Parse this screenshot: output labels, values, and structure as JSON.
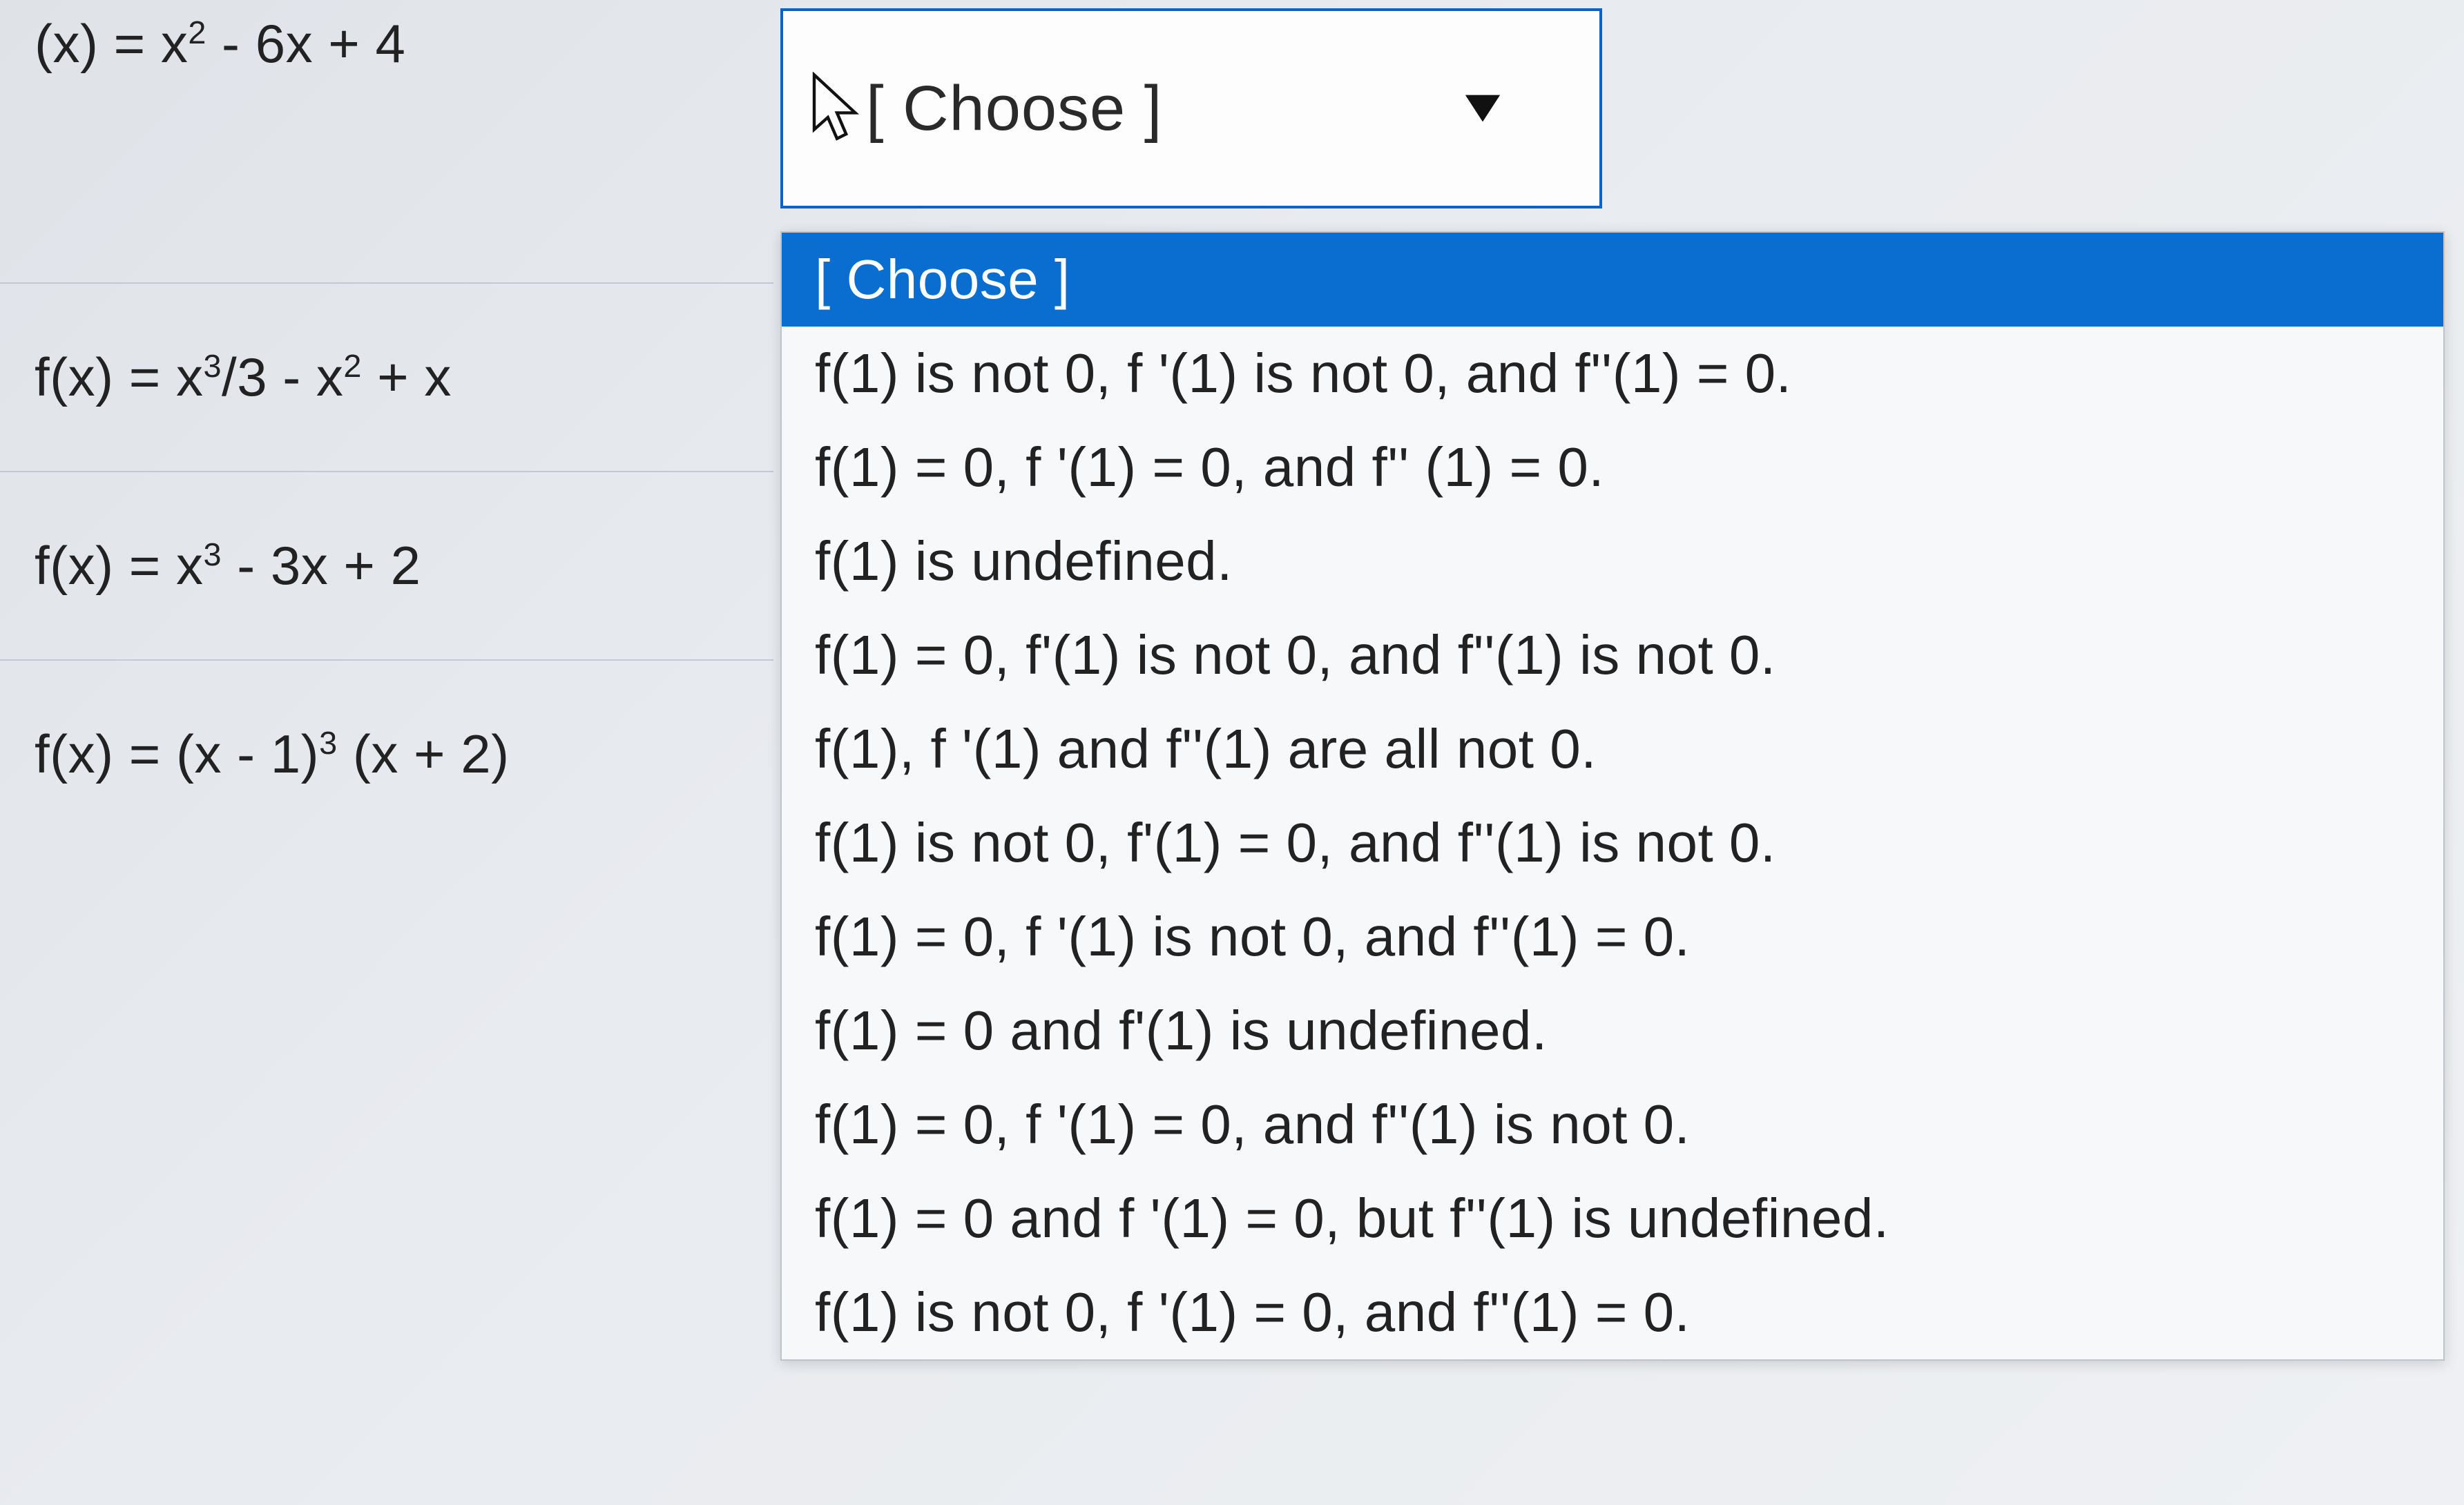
{
  "functions": [
    {
      "html": "(x) = x<sup>2</sup> - 6x + 4"
    },
    {
      "html": "f(x) = x<sup>3</sup>/3 - x<sup>2</sup> + x"
    },
    {
      "html": "f(x) = x<sup>3</sup> - 3x + 2"
    },
    {
      "html": "f(x) = (x - 1)<sup>3</sup> (x + 2)"
    }
  ],
  "select": {
    "display": "[ Choose ]"
  },
  "options": [
    "[ Choose ]",
    "f(1) is not 0, f '(1) is not 0, and f''(1) = 0.",
    "f(1) = 0, f '(1) = 0, and f'' (1) = 0.",
    "f(1)  is undefined.",
    "f(1) = 0, f'(1) is not 0, and f''(1) is not 0.",
    "f(1), f '(1) and f''(1) are all not 0.",
    "f(1) is not 0, f'(1) = 0, and f''(1) is not 0.",
    "f(1) = 0, f '(1) is not 0, and f''(1) = 0.",
    "f(1) = 0 and f'(1) is undefined.",
    "f(1) = 0, f '(1) = 0, and f''(1) is not 0.",
    "f(1) =  0 and f '(1) = 0, but f''(1) is undefined.",
    "f(1) is not 0, f '(1) = 0, and f''(1) = 0."
  ],
  "selectedIndex": 0
}
